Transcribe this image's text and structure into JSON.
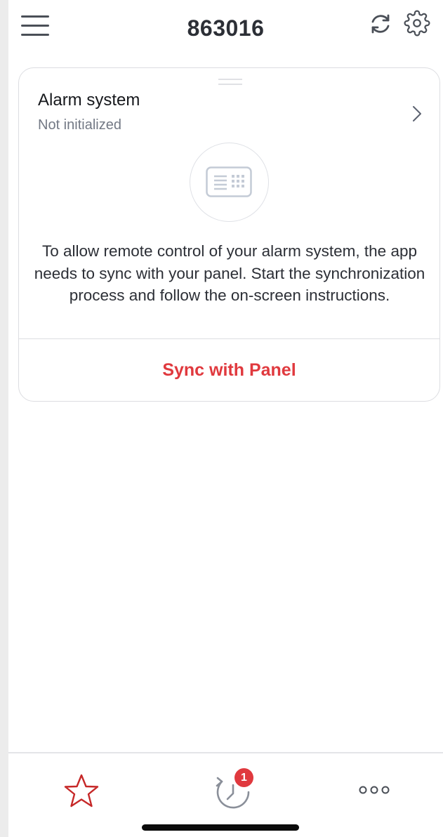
{
  "header": {
    "title": "863016"
  },
  "card": {
    "title": "Alarm system",
    "subtitle": "Not initialized",
    "description": "To allow remote control of your alarm system, the app needs to sync with your panel. Start the synchronization process and follow the on-screen instructions.",
    "action_label": "Sync with Panel"
  },
  "tabbar": {
    "history_badge": "1"
  },
  "colors": {
    "accent": "#e0393e",
    "text_primary": "#2c2f36",
    "text_secondary": "#737985"
  },
  "icons": [
    "menu-icon",
    "refresh-icon",
    "gear-icon",
    "chevron-right-icon",
    "keypad-panel-icon",
    "star-icon",
    "history-icon",
    "more-icon"
  ]
}
